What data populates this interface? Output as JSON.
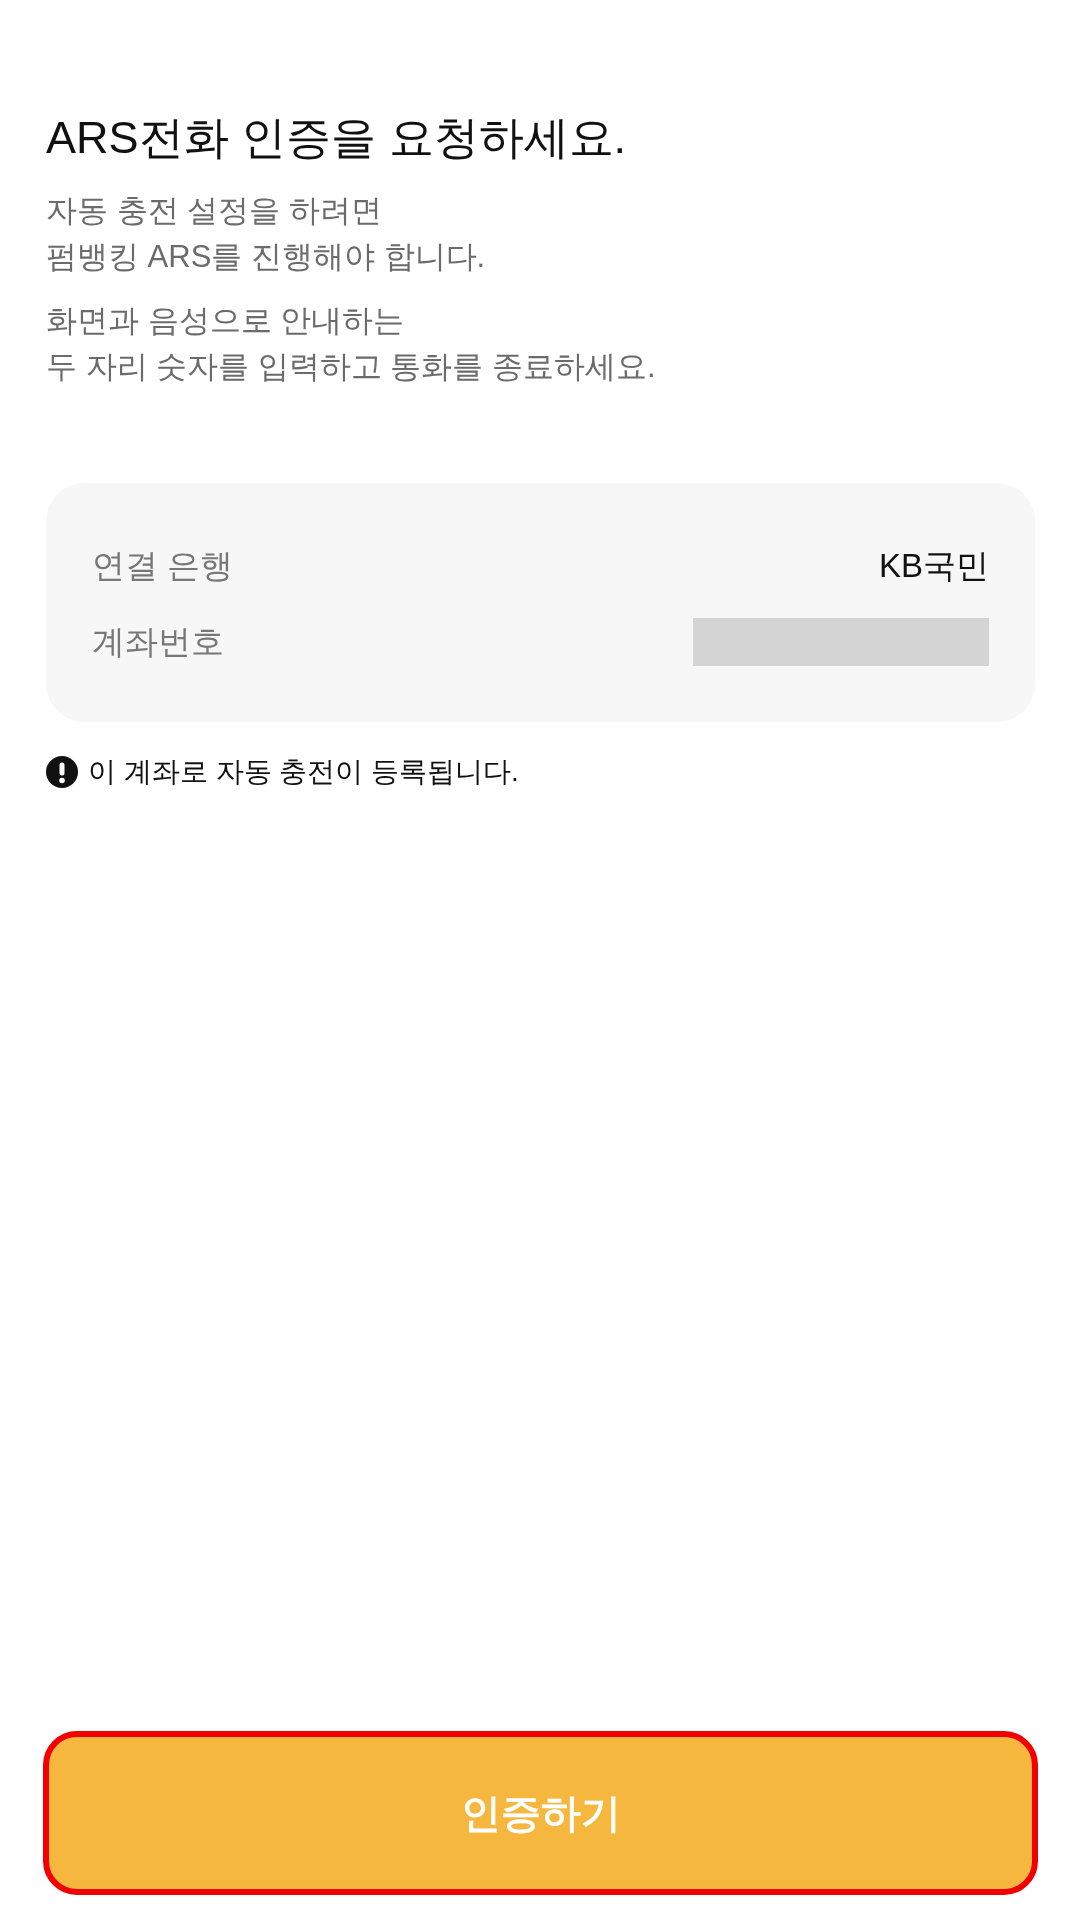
{
  "title": "ARS전화 인증을 요청하세요.",
  "descriptions": [
    {
      "text": "자동 충전 설정을 하려면\n펌뱅킹 ARS를 진행해야 합니다."
    },
    {
      "text": "화면과 음성으로 안내하는\n두 자리 숫자를 입력하고 통화를 종료하세요."
    }
  ],
  "account_card": {
    "rows": [
      {
        "kind": "text",
        "label": "연결 은행",
        "value": "KB국민"
      },
      {
        "kind": "redacted",
        "label": "계좌번호"
      }
    ]
  },
  "notice": {
    "text": "이 계좌로 자동 충전이 등록됩니다."
  },
  "button": {
    "label": "인증하기",
    "highlighted": true
  }
}
